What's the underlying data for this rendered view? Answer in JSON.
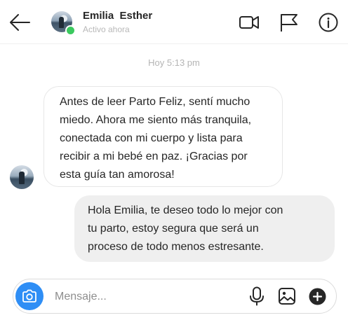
{
  "header": {
    "back_icon": "arrow-left-icon",
    "contact_name": "Emilia  Esther",
    "status": "Activo ahora",
    "status_color": "#3bc95f",
    "actions": [
      "video-call-icon",
      "flag-icon",
      "info-icon"
    ]
  },
  "conversation": {
    "timestamp": "Hoy 5:13 pm",
    "messages": [
      {
        "sender": "contact",
        "text": "Antes de leer Parto Feliz, sentí mucho\nmiedo. Ahora me siento más tranquila,\nconectada con mi cuerpo y lista para\nrecibir a mi bebé en paz. ¡Gracias por\nesta guía tan amorosa!"
      },
      {
        "sender": "me",
        "text": "Hola Emilia, te deseo todo lo mejor con\ntu parto, estoy segura que será un\nproceso de todo menos estresante."
      }
    ]
  },
  "composer": {
    "placeholder": "Mensaje...",
    "value": "",
    "camera_icon": "camera-icon",
    "icons": [
      "microphone-icon",
      "image-icon",
      "add-icon"
    ],
    "accent": "#2f8ef5"
  }
}
